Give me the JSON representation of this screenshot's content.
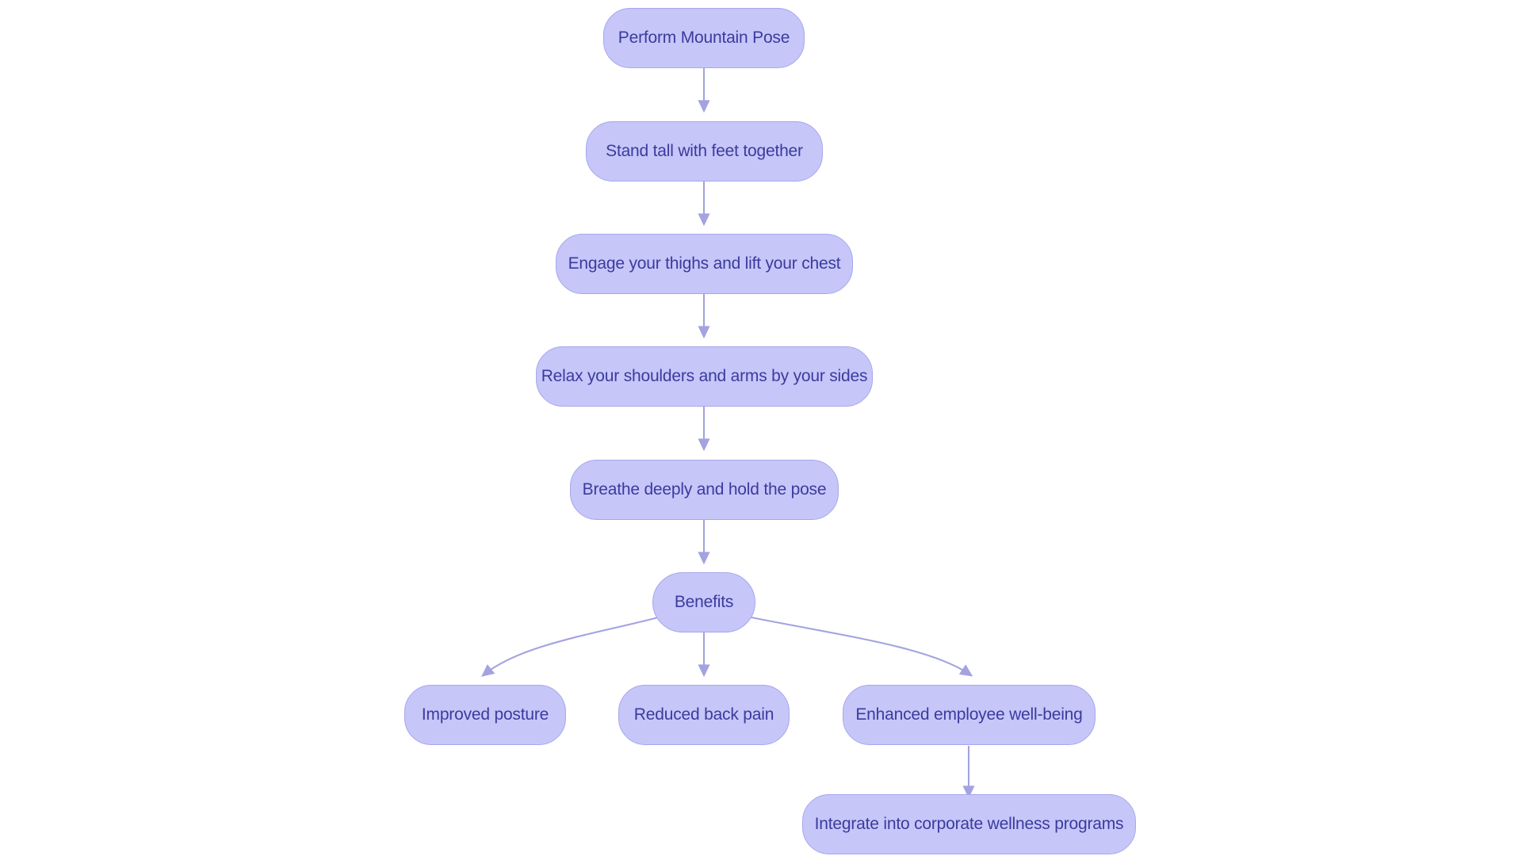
{
  "diagram": {
    "type": "flowchart",
    "orientation": "top-to-bottom",
    "background_color": "#ffffff",
    "node_fill_color": "#c6c6f9",
    "node_border_color": "#a7a7ec",
    "node_text_color": "#3b3b9e",
    "edge_color": "#a3a3e0",
    "nodes": [
      {
        "id": "n1",
        "label": "Perform Mountain Pose"
      },
      {
        "id": "n2",
        "label": "Stand tall with feet together"
      },
      {
        "id": "n3",
        "label": "Engage your thighs and lift your chest"
      },
      {
        "id": "n4",
        "label": "Relax your shoulders and arms by your sides"
      },
      {
        "id": "n5",
        "label": "Breathe deeply and hold the pose"
      },
      {
        "id": "n6",
        "label": "Benefits"
      },
      {
        "id": "n7",
        "label": "Improved posture"
      },
      {
        "id": "n8",
        "label": "Reduced back pain"
      },
      {
        "id": "n9",
        "label": "Enhanced employee well-being"
      },
      {
        "id": "n10",
        "label": "Integrate into corporate wellness programs"
      }
    ],
    "edges": [
      {
        "from": "n1",
        "to": "n2",
        "style": "straight-arrow"
      },
      {
        "from": "n2",
        "to": "n3",
        "style": "straight-arrow"
      },
      {
        "from": "n3",
        "to": "n4",
        "style": "straight-arrow"
      },
      {
        "from": "n4",
        "to": "n5",
        "style": "straight-arrow"
      },
      {
        "from": "n5",
        "to": "n6",
        "style": "straight-arrow"
      },
      {
        "from": "n6",
        "to": "n7",
        "style": "curved-arrow"
      },
      {
        "from": "n6",
        "to": "n8",
        "style": "straight-arrow"
      },
      {
        "from": "n6",
        "to": "n9",
        "style": "curved-arrow"
      },
      {
        "from": "n9",
        "to": "n10",
        "style": "straight-arrow"
      }
    ]
  }
}
